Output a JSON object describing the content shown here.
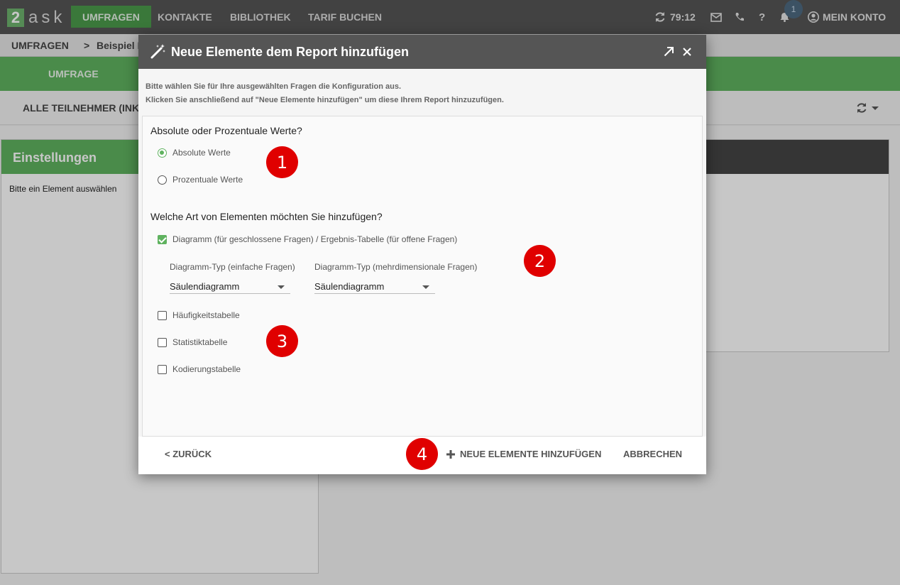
{
  "topbar": {
    "logo_digit": "2",
    "logo_text": "ask",
    "nav": [
      "UMFRAGEN",
      "KONTAKTE",
      "BIBLIOTHEK",
      "TARIF BUCHEN"
    ],
    "session_timer": "79:12",
    "notification_count": "1",
    "account_label": "MEIN KONTO"
  },
  "breadcrumb": {
    "root": "UMFRAGEN",
    "separator": ">",
    "current": "Beispiel M"
  },
  "tabs": {
    "active": "UMFRAGE"
  },
  "filter": {
    "label": "ALLE TEILNEHMER (INKL."
  },
  "left_panel": {
    "title": "Einstellungen",
    "empty_text": "Bitte ein Element auswählen"
  },
  "modal": {
    "title": "Neue Elemente dem Report hinzufügen",
    "intro_line1": "Bitte wählen Sie für Ihre ausgewählten Fragen die Konfiguration aus.",
    "intro_line2": "Klicken Sie anschließend auf \"Neue Elemente hinzufügen\" um diese Ihrem Report hinzuzufügen.",
    "q1_title": "Absolute oder Prozentuale Werte?",
    "q1_options": [
      {
        "label": "Absolute Werte",
        "selected": true
      },
      {
        "label": "Prozentuale Werte",
        "selected": false
      }
    ],
    "q2_title": "Welche Art von Elementen möchten Sie hinzufügen?",
    "diagram_option": {
      "label": "Diagramm (für geschlossene Fragen) / Ergebnis-Tabelle (für offene Fragen)",
      "checked": true
    },
    "diagram_type_simple": {
      "label": "Diagramm-Typ (einfache Fragen)",
      "value": "Säulendiagramm"
    },
    "diagram_type_multi": {
      "label": "Diagramm-Typ (mehrdimensionale Fragen)",
      "value": "Säulendiagramm"
    },
    "table_options": [
      {
        "label": "Häufigkeitstabelle",
        "checked": false
      },
      {
        "label": "Statistiktabelle",
        "checked": false
      },
      {
        "label": "Kodierungstabelle",
        "checked": false
      }
    ],
    "back_label": "< ZURÜCK",
    "add_label": "NEUE ELEMENTE HINZUFÜGEN",
    "cancel_label": "ABBRECHEN"
  },
  "annotations": [
    "1",
    "2",
    "3",
    "4"
  ],
  "colors": {
    "brand_green": "#5fb25f",
    "topbar": "#555555",
    "marker_red": "#e00000"
  }
}
